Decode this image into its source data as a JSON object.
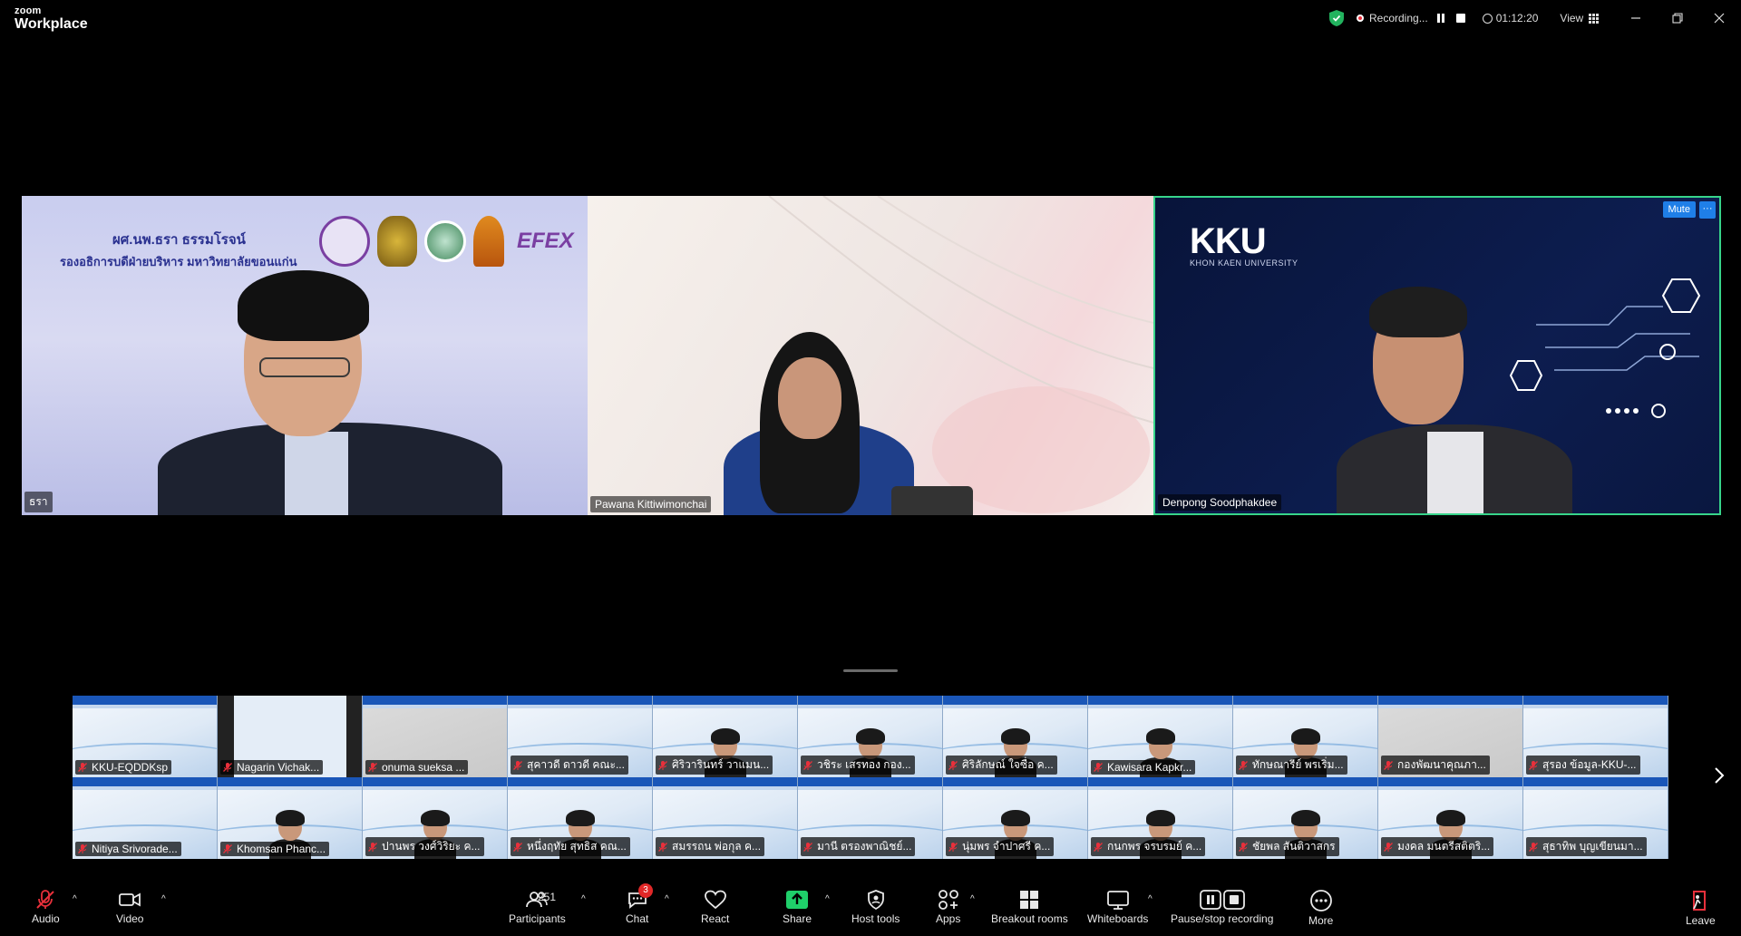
{
  "app": {
    "logo_small": "zoom",
    "logo_big": "Workplace"
  },
  "titlebar": {
    "recording_label": "Recording...",
    "timer": "01:12:20",
    "view_label": "View",
    "minimize_icon": "minimize-icon",
    "restore_icon": "restore-icon",
    "close_icon": "close-icon"
  },
  "speakers": [
    {
      "name": "ธรา",
      "slide_title": "ผศ.นพ.ธรา ธรรมโรจน์",
      "slide_subtitle": "รองอธิการบดีฝ่ายบริหาร มหาวิทยาลัยขอนแก่น",
      "slide_brand": "EFEX"
    },
    {
      "name": "Pawana Kittiwimonchai"
    },
    {
      "name": "Denpong Soodphakdee",
      "bg_logo": "KKU",
      "bg_logo_sub": "KHON KAEN UNIVERSITY",
      "mute_label": "Mute",
      "more_label": "···",
      "active_speaker_color": "#37d48a"
    }
  ],
  "gallery": {
    "participants": [
      {
        "name": "KKU-EQDDKsp",
        "style": "slide"
      },
      {
        "name": "Nagarin Vichak...",
        "style": "dark-sides"
      },
      {
        "name": "onuma sueksa ...",
        "style": "grey"
      },
      {
        "name": "สุคาวดี ดาวดี คณะ...",
        "style": "slide"
      },
      {
        "name": "ศิริวารินทร์ วาแมน...",
        "style": "person"
      },
      {
        "name": "วชิระ เสรทอง กอง...",
        "style": "person"
      },
      {
        "name": "ศิริลักษณ์ ใจซื่อ ค...",
        "style": "person"
      },
      {
        "name": "Kawisara Kapkr...",
        "style": "person"
      },
      {
        "name": "ทักษณารีย์ พรเริ่ม...",
        "style": "person"
      },
      {
        "name": "กองพัฒนาคุณภา...",
        "style": "grey"
      },
      {
        "name": "สุรอง ข้อมูล-KKU-...",
        "style": "slide"
      },
      {
        "name": "Nitiya Srivorade...",
        "style": "slide"
      },
      {
        "name": "Khomsan Phanc...",
        "style": "person"
      },
      {
        "name": "ปานพร วงศ์วิริยะ ค...",
        "style": "person"
      },
      {
        "name": "หนึ่งฤทัย สุทธิส คณ...",
        "style": "person"
      },
      {
        "name": "สมรรถน พ่อกุล ค...",
        "style": "slide"
      },
      {
        "name": "มานี ตรองพาณิชย์...",
        "style": "slide"
      },
      {
        "name": "นุ่มพร จำปาศรี ค...",
        "style": "person"
      },
      {
        "name": "กนกพร จรบรมย์ ค...",
        "style": "person"
      },
      {
        "name": "ชัยพล สันติวาสกร",
        "style": "person"
      },
      {
        "name": "มงคล มนตรีสติตริ...",
        "style": "person"
      },
      {
        "name": "สุธาทิพ บุญเขียนมา...",
        "style": "slide"
      }
    ],
    "next_icon": "chevron-right-icon"
  },
  "toolbar": {
    "audio": "Audio",
    "video": "Video",
    "participants": "Participants",
    "participants_count": "251",
    "chat": "Chat",
    "chat_badge": "3",
    "react": "React",
    "share": "Share",
    "host_tools": "Host tools",
    "apps": "Apps",
    "breakout_rooms": "Breakout rooms",
    "whiteboards": "Whiteboards",
    "pause_stop_recording": "Pause/stop recording",
    "more": "More",
    "leave": "Leave"
  },
  "colors": {
    "share_green": "#1fcf6a",
    "muted_red": "#e8303b",
    "leave_red": "#e8303b",
    "accent_blue": "#1f7fe8"
  }
}
